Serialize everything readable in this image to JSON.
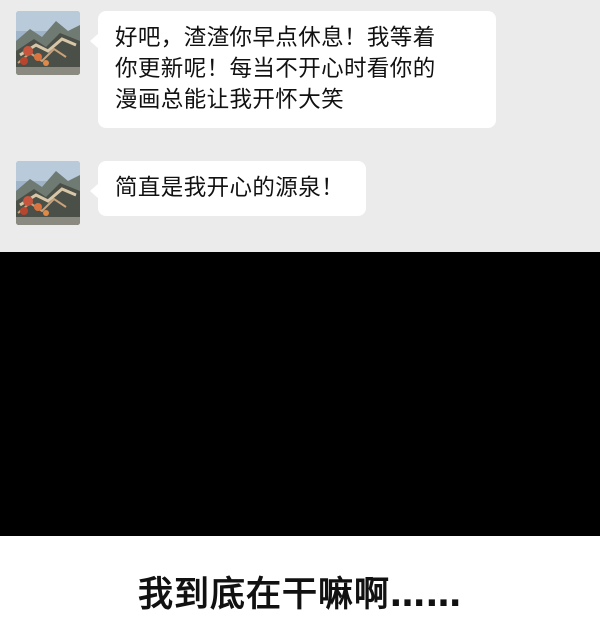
{
  "chat": {
    "background": "#ebebeb",
    "messages": [
      {
        "avatar_icon": "great-wall-avatar-icon",
        "lines": [
          "好吧，渣渣你早点休息！我等着",
          "你更新呢！每当不开心时看你的",
          "漫画总能让我开怀大笑"
        ]
      },
      {
        "avatar_icon": "great-wall-avatar-icon",
        "lines": [
          "简直是我开心的源泉！"
        ]
      }
    ]
  },
  "black_panel": {
    "color": "#000000"
  },
  "caption": {
    "text": "我到底在干嘛啊……"
  }
}
